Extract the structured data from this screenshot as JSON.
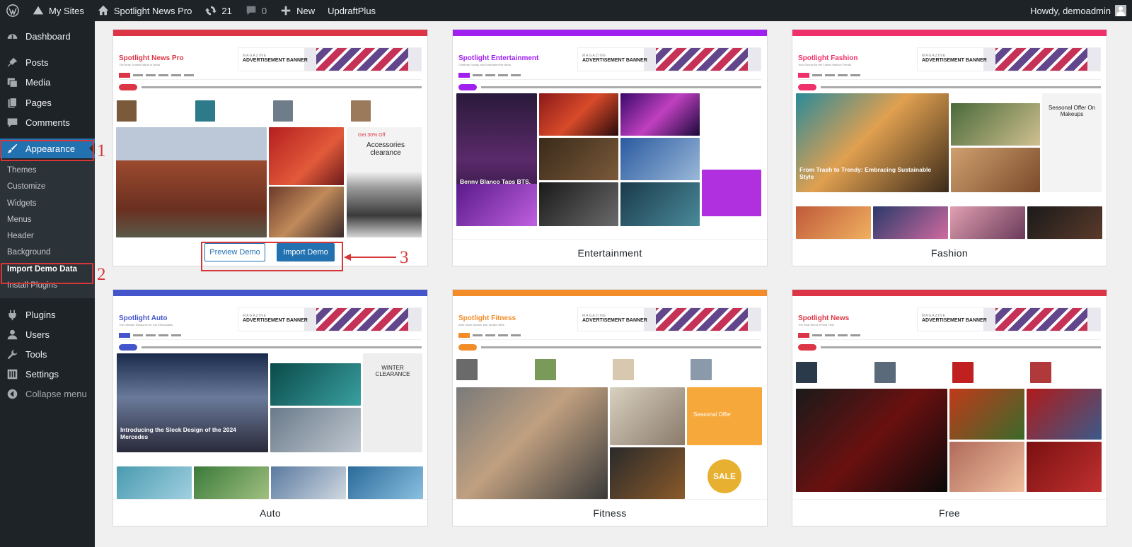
{
  "admin_bar": {
    "my_sites": "My Sites",
    "site_name": "Spotlight News Pro",
    "updates_count": "21",
    "comments_count": "0",
    "new_label": "New",
    "plugin_link": "UpdraftPlus",
    "howdy": "Howdy, demoadmin"
  },
  "sidebar": {
    "dashboard": "Dashboard",
    "posts": "Posts",
    "media": "Media",
    "pages": "Pages",
    "comments": "Comments",
    "appearance": "Appearance",
    "submenu": [
      "Themes",
      "Customize",
      "Widgets",
      "Menus",
      "Header",
      "Background",
      "Import Demo Data",
      "Install Plugins"
    ],
    "plugins": "Plugins",
    "users": "Users",
    "tools": "Tools",
    "settings": "Settings",
    "collapse": "Collapse menu"
  },
  "annotations": {
    "step1": "1",
    "step2": "2",
    "step3": "3",
    "color": "#d63638"
  },
  "demos": [
    {
      "name": "Spotlight News Pro",
      "tagline": "The Most Trusted Name in News",
      "accent": "#dc3545",
      "preview_label": "Preview Demo",
      "import_label": "Import Demo"
    },
    {
      "name": "Entertainment",
      "site_title": "Spotlight Entertainment",
      "tagline": "Celebrity Gossip and Entertainment News",
      "accent": "#a020f0"
    },
    {
      "name": "Fashion",
      "site_title": "Spotlight Fashion",
      "tagline": "Your Source for the Latest Fashion Trends",
      "accent": "#f0306a"
    },
    {
      "name": "Auto",
      "site_title": "Spotlight Auto",
      "tagline": "The Ultimate Resource for Car Enthusiasts",
      "accent": "#4455cc"
    },
    {
      "name": "Fitness",
      "site_title": "Spotlight Fitness",
      "tagline": "write down fashion side section titles",
      "accent": "#f28c28"
    },
    {
      "name": "Free",
      "site_title": "Spotlight News",
      "tagline": "The Real World in Real Time",
      "accent": "#dc3545"
    }
  ],
  "banner": {
    "line1": "MAGAZINE",
    "line2": "ADVERTISEMENT BANNER"
  },
  "headline": "Benny Blanco Taps BTS, Snoop Dogg for 'Bad Decisions'",
  "fashion_headline": "From Trash to Trendy: Embracing Sustainable Style",
  "auto_headline": "Introducing the Sleek Design of the 2024 Mercedes",
  "promo": {
    "accessories": "Accessories clearance",
    "get30": "Get 30% Off",
    "winter": "WINTER CLEARANCE",
    "seasonal": "Seasonal Offer On Makeups",
    "sale": "SALE",
    "seasonal_fitness": "Seasonal Offer"
  }
}
